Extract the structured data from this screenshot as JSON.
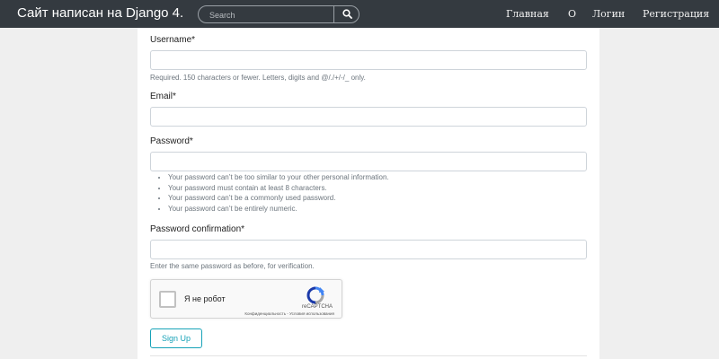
{
  "navbar": {
    "brand": "Сайт написан на Django 4.",
    "search_placeholder": "Search",
    "links": [
      "Главная",
      "О",
      "Логин",
      "Регистрация"
    ]
  },
  "form": {
    "username": {
      "label": "Username*",
      "value": "",
      "help": "Required. 150 characters or fewer. Letters, digits and @/./+/-/_ only."
    },
    "email": {
      "label": "Email*",
      "value": ""
    },
    "password": {
      "label": "Password*",
      "value": "",
      "rules": [
        "Your password can’t be too similar to your other personal information.",
        "Your password must contain at least 8 characters.",
        "Your password can’t be a commonly used password.",
        "Your password can’t be entirely numeric."
      ]
    },
    "password2": {
      "label": "Password confirmation*",
      "value": "",
      "help": "Enter the same password as before, for verification."
    },
    "captcha": {
      "label": "Я не робот",
      "brand": "reCAPTCHA",
      "terms": "Конфиденциальность - Условия использования",
      "checked": false
    },
    "submit_label": "Sign Up"
  },
  "colors": {
    "navbar": "#343a40",
    "accent": "#17a2b8",
    "background": "#efefef"
  },
  "icons": {
    "search": "search-icon",
    "recaptcha": "recaptcha-logo-icon"
  }
}
